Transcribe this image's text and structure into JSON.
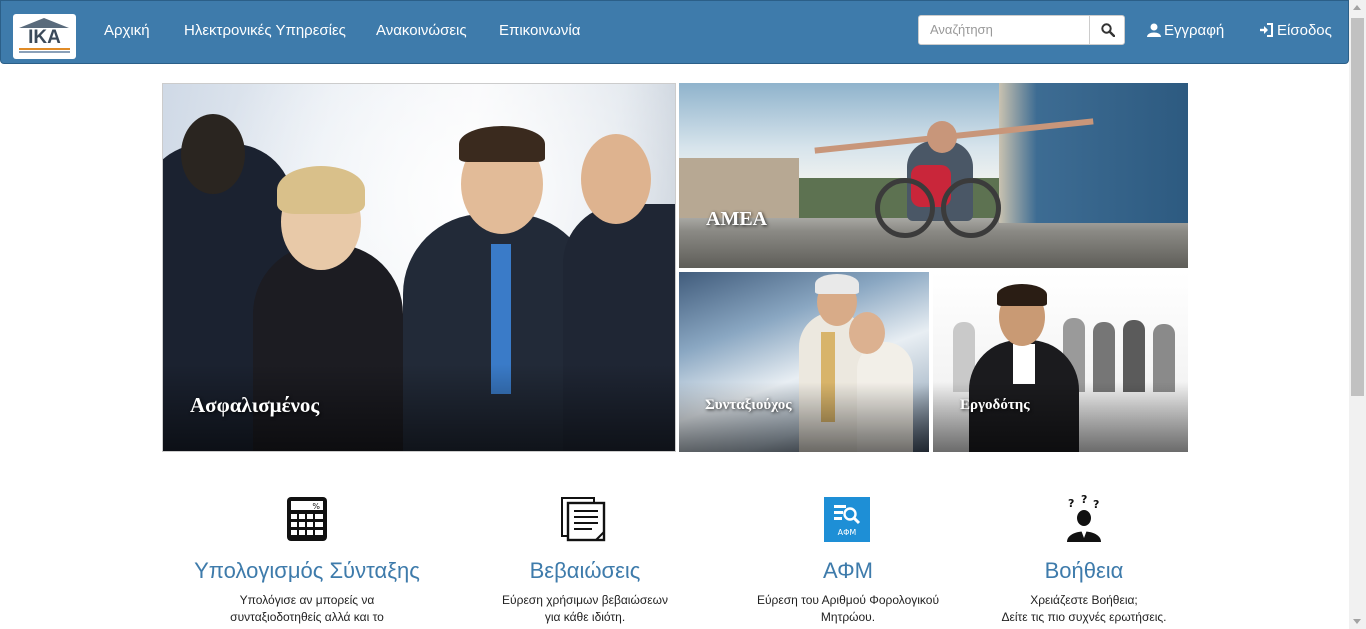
{
  "nav": {
    "logo_text": "IKA",
    "links": [
      "Αρχική",
      "Ηλεκτρονικές Υπηρεσίες",
      "Ανακοινώσεις",
      "Επικοινωνία"
    ],
    "search_placeholder": "Αναζήτηση",
    "register_label": "Εγγραφή",
    "login_label": "Είσοδος"
  },
  "tiles": {
    "insured": "Ασφαλισμένος",
    "amea": "ΑΜΕΑ",
    "pensioner": "Συνταξιούχος",
    "employer": "Εργοδότης"
  },
  "features": [
    {
      "icon": "calculator-icon",
      "title": "Υπολογισμός Σύνταξης",
      "desc1": "Υπολόγισε αν μπορείς να",
      "desc2": "συνταξιοδοτηθείς αλλά και το"
    },
    {
      "icon": "documents-icon",
      "title": "Βεβαιώσεις",
      "desc1": "Εύρεση χρήσιμων βεβαιώσεων",
      "desc2": "για κάθε ιδιότη."
    },
    {
      "icon": "afm-search-icon",
      "icon_text": "ΑΦΜ",
      "title": "ΑΦΜ",
      "desc1": "Εύρεση του Αριθμού Φορολογικού",
      "desc2": "Μητρώου."
    },
    {
      "icon": "help-person-icon",
      "title": "Βοήθεια",
      "desc1": "Χρειάζεστε Βοήθεια;",
      "desc2": "Δείτε τις πιο συχνές ερωτήσεις."
    }
  ],
  "colors": {
    "navbar": "#3e7bab",
    "accent_title": "#3e7bab",
    "afm_icon_bg": "#1e8fd6"
  }
}
